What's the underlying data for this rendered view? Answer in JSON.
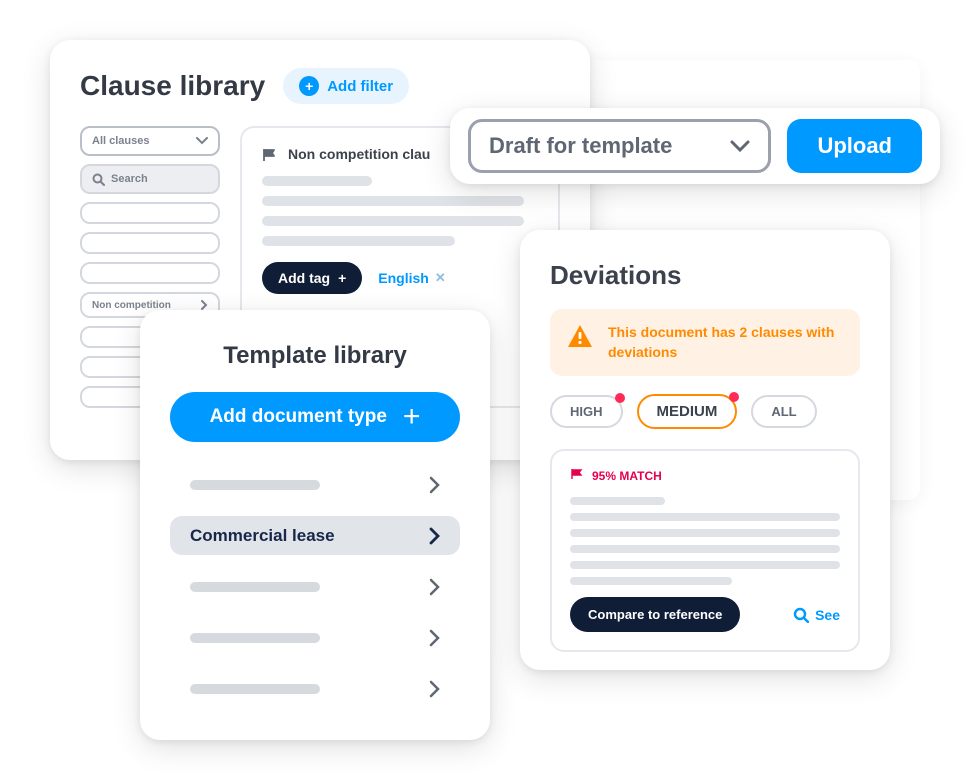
{
  "clause": {
    "title": "Clause library",
    "add_filter": "Add filter",
    "select": "All clauses",
    "search_placeholder": "Search",
    "sidebar_item": "Non competition",
    "main_title": "Non competition clau",
    "add_tag": "Add tag",
    "language": "English"
  },
  "action_bar": {
    "draft": "Draft for template",
    "upload": "Upload"
  },
  "template": {
    "title": "Template library",
    "add_doc": "Add document type",
    "lease": "Commercial lease"
  },
  "deviations": {
    "title": "Deviations",
    "alert": "This document has 2 clauses with deviations",
    "filters": {
      "high": "HIGH",
      "medium": "MEDIUM",
      "all": "ALL"
    },
    "match": "95% MATCH",
    "compare": "Compare to reference",
    "see": "See"
  }
}
